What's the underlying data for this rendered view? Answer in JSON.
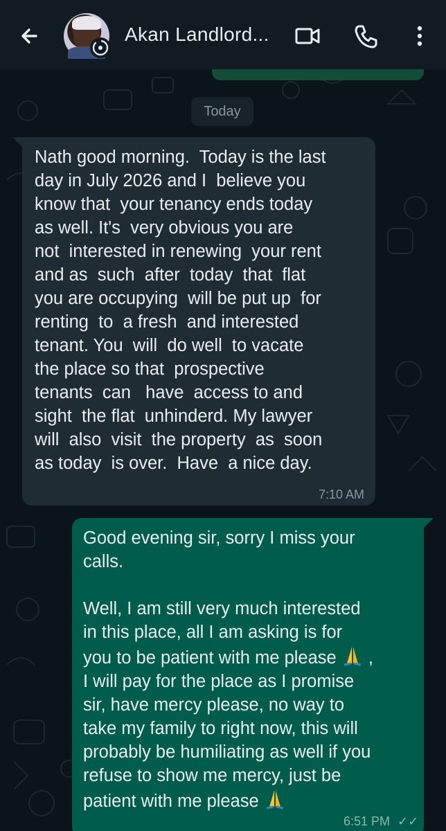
{
  "header": {
    "contact_name": "Akan Landlord...",
    "icons": {
      "back": "arrow-back-icon",
      "video": "video-call-icon",
      "voice": "phone-icon",
      "menu": "more-vertical-icon"
    }
  },
  "date_chip": "Today",
  "messages": [
    {
      "direction": "incoming",
      "text": "Nath good morning.  Today is the last\nday in July 2026 and I  believe you\nknow that  your tenancy ends today\nas well. It's  very obvious you are\nnot  interested in renewing  your rent\nand as  such  after  today  that  flat\nyou are occupying  will be put up  for\nrenting  to  a fresh  and interested\ntenant. You  will  do well  to vacate\nthe place so that  prospective\ntenants  can   have  access to and\nsight  the flat  unhinderd. My lawyer\nwill  also  visit  the property  as  soon\nas today  is over.  Have  a nice day.",
      "time": "7:10 AM"
    },
    {
      "direction": "outgoing",
      "line1": "Good evening sir, sorry I miss your\ncalls.\n\nWell, I am still very much interested\nin this place, all I am asking is for\nyou to be patient with me please ",
      "line2": " ,\nI will pay for the place as I promise\nsir, have mercy please, no way to\ntake my family to right now, this will\nprobably be humiliating as well if you\nrefuse to show me mercy, just be\npatient with me please ",
      "emoji_name": "folded-hands-emoji",
      "time": "6:51 PM",
      "ticks": "✓✓"
    }
  ],
  "colors": {
    "background": "#0b141a",
    "header": "#121b22",
    "incoming_bubble": "#202c33",
    "outgoing_bubble": "#005c4b",
    "text": "#e9edef",
    "meta": "#8696a0"
  }
}
